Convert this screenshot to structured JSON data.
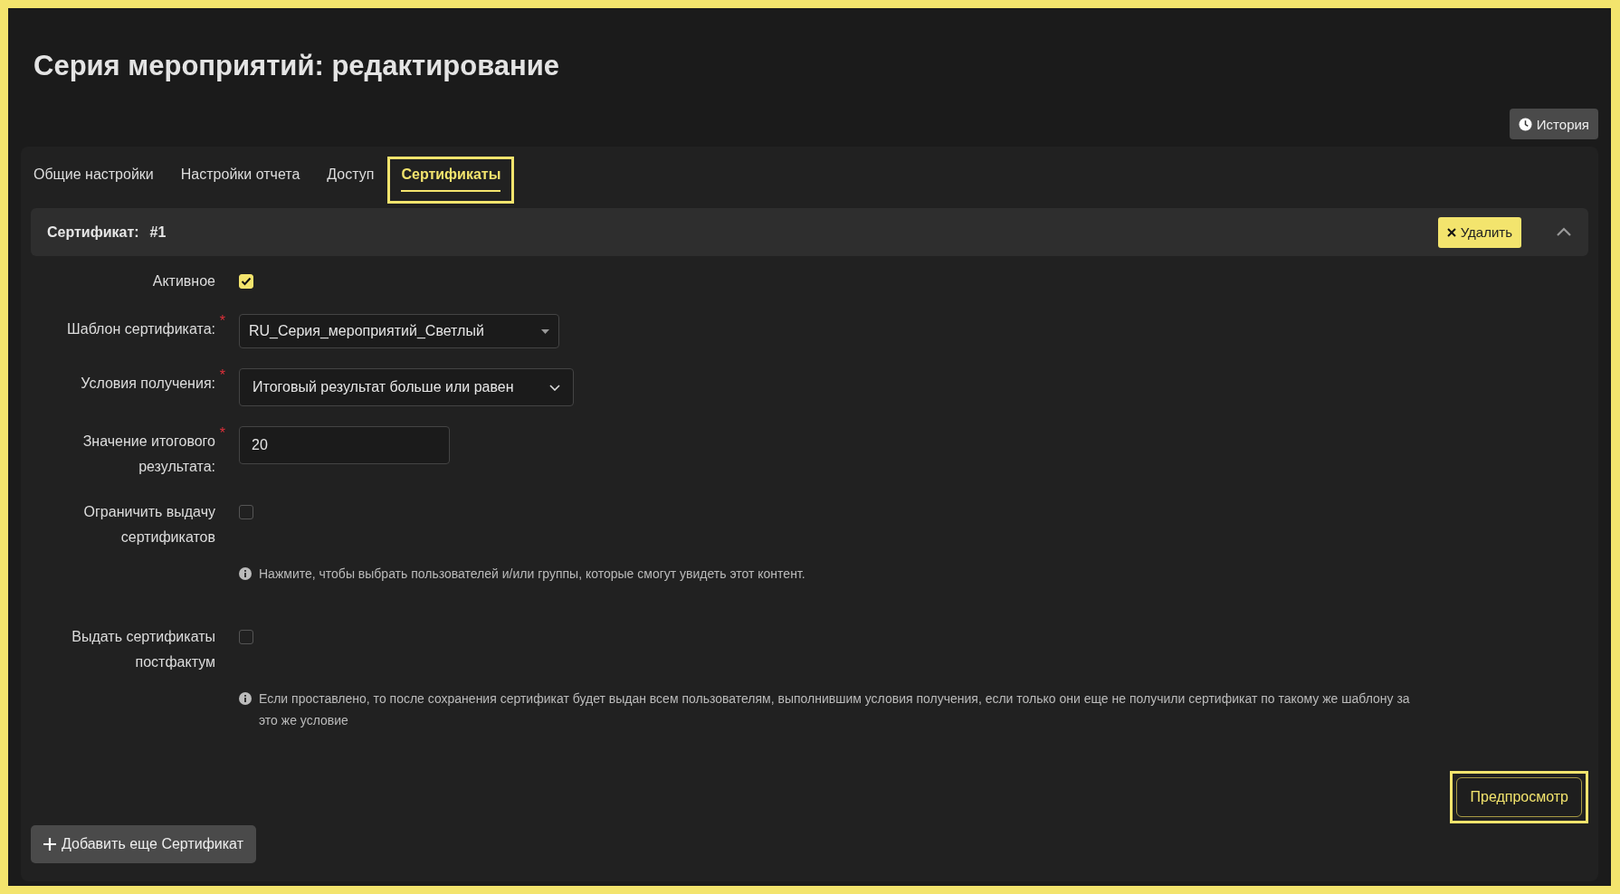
{
  "page": {
    "title": "Серия мероприятий: редактирование"
  },
  "history_button": {
    "label": "История"
  },
  "tabs": [
    {
      "label": "Общие настройки",
      "selected": false,
      "highlighted": false
    },
    {
      "label": "Настройки отчета",
      "selected": false,
      "highlighted": false
    },
    {
      "label": "Доступ",
      "selected": false,
      "highlighted": false
    },
    {
      "label": "Сертификаты",
      "selected": true,
      "highlighted": true
    }
  ],
  "certificate": {
    "title": "Сертификат:",
    "number": "#1",
    "delete_button": "Удалить",
    "expanded": true
  },
  "fields": [
    {
      "kind": "checkbox",
      "label": "Активное",
      "checked": true
    },
    {
      "kind": "select",
      "label": "Шаблон сертификата:",
      "required_mark": "*",
      "value": "RU_Серия_мероприятий_Светлый"
    },
    {
      "kind": "dropdown",
      "label": "Условия получения:",
      "required_mark": "*",
      "value": "Итоговый результат больше или равен"
    },
    {
      "kind": "input",
      "label": "Значение итогового результата:",
      "required_mark": "*",
      "value": "20"
    },
    {
      "kind": "checkbox",
      "label": "Ограничить выдачу сертификатов",
      "checked": false,
      "hint": "Нажмите, чтобы выбрать пользователей и/или группы, которые смогут увидеть этот контент."
    },
    {
      "kind": "checkbox",
      "label": "Выдать сертификаты постфактум",
      "checked": false,
      "hint": "Если проставлено, то после сохранения сертификат будет выдан всем пользователям, выполнившим условия получения, если только они еще не получили сертификат по такому же шаблону за это же условие"
    }
  ],
  "preview_button": {
    "label": "Предпросмотр",
    "highlighted": true
  },
  "add_button": {
    "label": "Добавить еще Сертификат"
  }
}
